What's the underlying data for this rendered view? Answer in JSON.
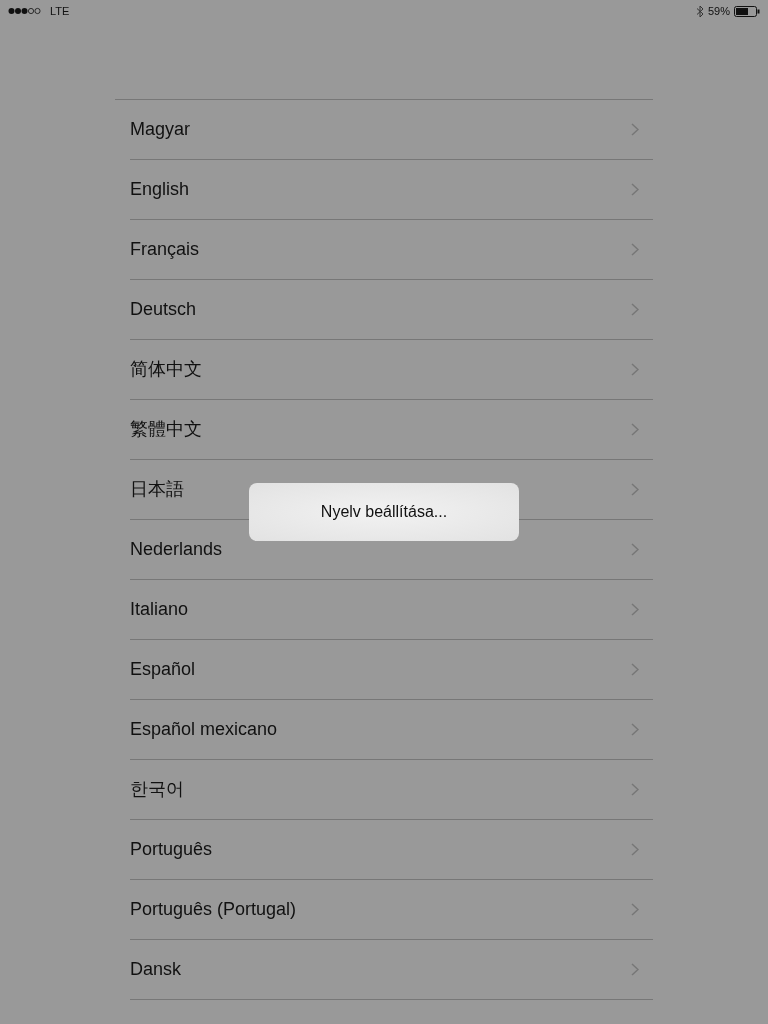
{
  "status_bar": {
    "carrier": "LTE",
    "battery": "59%"
  },
  "languages": [
    {
      "label": "Magyar"
    },
    {
      "label": "English"
    },
    {
      "label": "Français"
    },
    {
      "label": "Deutsch"
    },
    {
      "label": "简体中文"
    },
    {
      "label": "繁體中文"
    },
    {
      "label": "日本語"
    },
    {
      "label": "Nederlands"
    },
    {
      "label": "Italiano"
    },
    {
      "label": "Español"
    },
    {
      "label": "Español mexicano"
    },
    {
      "label": "한국어"
    },
    {
      "label": "Português"
    },
    {
      "label": "Português (Portugal)"
    },
    {
      "label": "Dansk"
    }
  ],
  "overlay": {
    "message": "Nyelv beállítása..."
  }
}
